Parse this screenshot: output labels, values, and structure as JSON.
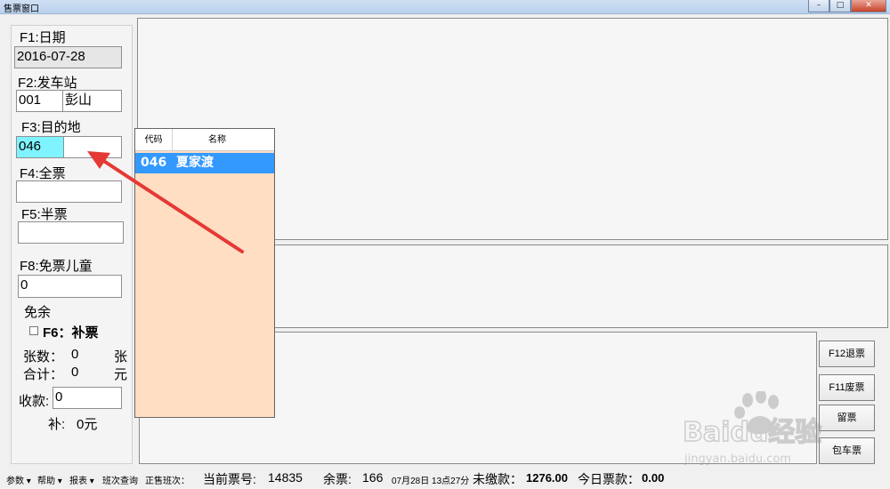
{
  "window": {
    "title": "售票窗口",
    "buttons": [
      "–",
      "□",
      "✕"
    ]
  },
  "form": {
    "date": {
      "label": "F1:日期",
      "value": "2016-07-28"
    },
    "departure": {
      "label": "F2:发车站",
      "code": "001",
      "name": "彭山"
    },
    "destination": {
      "label": "F3:目的地",
      "code": "046",
      "name": ""
    },
    "full_ticket": {
      "label": "F4:全票",
      "value": ""
    },
    "half_ticket": {
      "label": "F5:半票",
      "value": ""
    },
    "free_child": {
      "label": "F8:免票儿童",
      "value": "0"
    },
    "exempt_label": "免余",
    "supplement": {
      "label": "F6：补票",
      "checked": false
    },
    "count": {
      "label": "张数：",
      "value": "0",
      "unit": "张"
    },
    "total": {
      "label": "合计：",
      "value": "0",
      "unit": "元"
    },
    "received": {
      "label": "收款:",
      "value": "0"
    },
    "change": {
      "label": "补:",
      "value": "0元"
    }
  },
  "dropdown": {
    "headers": [
      "代码",
      "名称"
    ],
    "rows": [
      {
        "code": "046",
        "name": "夏家渡",
        "selected": true
      }
    ]
  },
  "buttons": {
    "refund": "F12退票",
    "void": "F11废票",
    "reserve": "留票",
    "charter": "包车票"
  },
  "statusbar": {
    "menus": [
      "参数",
      "帮助",
      "报表"
    ],
    "dropdown_marker": "▾",
    "schedule_query": "班次查询",
    "on_sale_label": "正售班次：",
    "ticket_no_label": "当前票号:",
    "ticket_no": "14835",
    "remaining_label": "余票:",
    "remaining": "166",
    "datetime": "07月28日 13点27分",
    "unpaid_label": "未缴款：",
    "unpaid": "1276.00",
    "today_label": "今日票款：",
    "today": "0.00"
  },
  "watermark": {
    "brand": "Baidu经验",
    "url": "jingyan.baidu.com"
  },
  "colors": {
    "selection": "#3399ff",
    "dropdown_bg": "#ffdec3",
    "active_field": "#7ff3ff",
    "arrow": "#e53935"
  }
}
